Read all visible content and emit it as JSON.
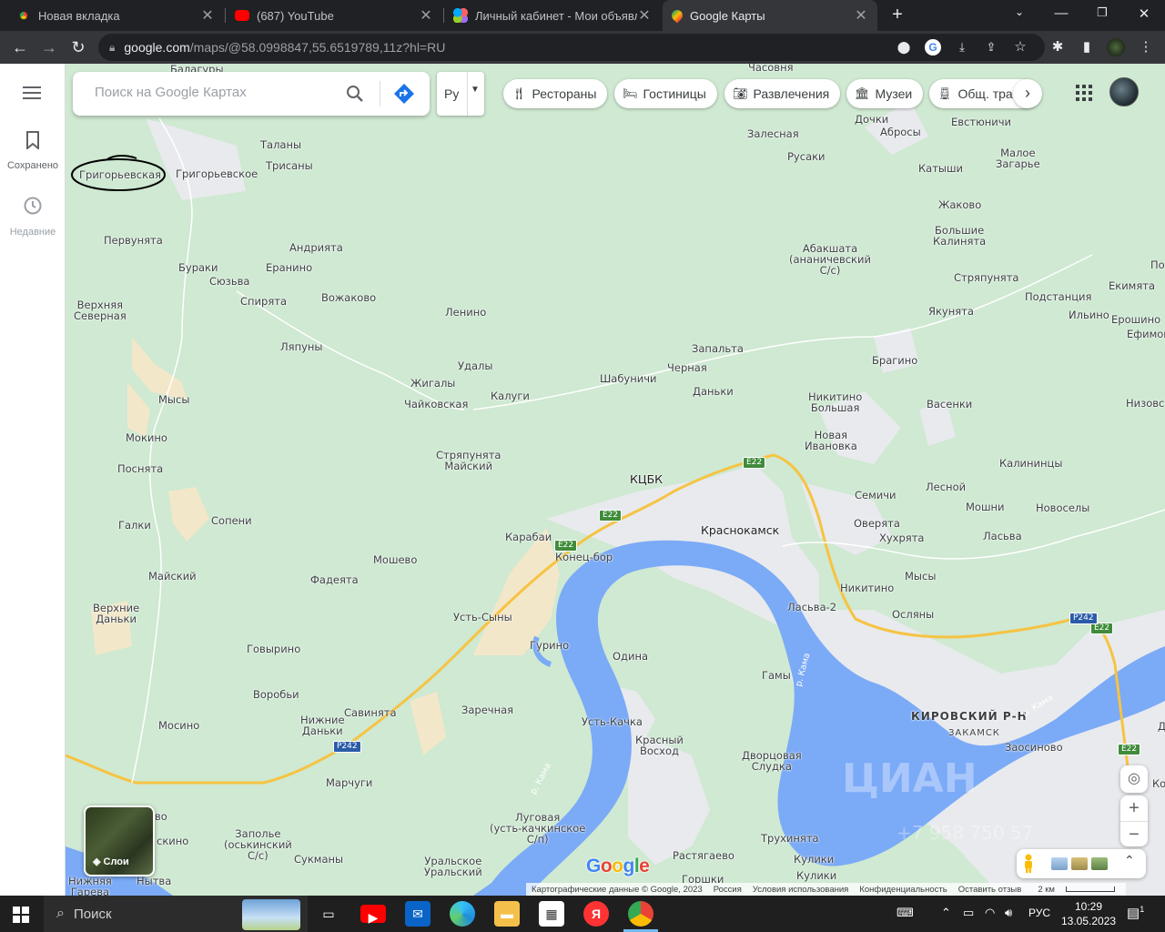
{
  "browser": {
    "tabs": [
      {
        "title": "Новая вкладка",
        "favicon": "chrome-icon",
        "active": false
      },
      {
        "title": "(687) YouTube",
        "favicon": "youtube-icon",
        "active": false
      },
      {
        "title": "Личный кабинет - Мои объявления",
        "favicon": "avito-icon",
        "active": false
      },
      {
        "title": "Google Карты",
        "favicon": "google-maps-icon",
        "active": true
      }
    ],
    "url_host": "google.com",
    "url_rest": "/maps/@58.0998847,55.6519789,11z?hl=RU"
  },
  "maps": {
    "search_placeholder": "Поиск на Google Картах",
    "language": "Ру",
    "sidebar": [
      {
        "label": "Сохранено",
        "icon": "bookmark-icon"
      },
      {
        "label": "Недавние",
        "icon": "history-icon"
      }
    ],
    "chips": [
      {
        "label": "Рестораны",
        "icon": "restaurant-icon"
      },
      {
        "label": "Гостиницы",
        "icon": "hotel-icon"
      },
      {
        "label": "Развлечения",
        "icon": "camera-icon"
      },
      {
        "label": "Музеи",
        "icon": "museum-icon"
      },
      {
        "label": "Общ. тра",
        "icon": "transit-icon"
      }
    ],
    "layers_label": "Слои",
    "attribution": [
      "Картографические данные © Google, 2023",
      "Россия",
      "Условия использования",
      "Конфиденциальность",
      "Оставить отзыв",
      "2 км"
    ],
    "logo": "Google",
    "watermark": "ЦИАН",
    "watermark_sub": "+7 958 750 57",
    "labels": {
      "balagury": "Балагуры",
      "chasovnya": "Часовня",
      "grigorevskaya": "Григорьевская",
      "grigorevskoe": "Григорьевское",
      "talany": "Таланы",
      "trisany": "Трисаны",
      "zalesnaya": "Залесная",
      "rusaki": "Русаки",
      "dochki": "Дочки",
      "abrosy": "Абросы",
      "evstyunichi": "Евстюничи",
      "maloe_zagare": "Малое\nЗагарье",
      "katyshi": "Катыши",
      "zhakovo": "Жаково",
      "bolshie_kalinyata": "Большие\nКалинята",
      "pervunyata": "Первунята",
      "andriyata": "Андрията",
      "buraki": "Бураки",
      "eranino": "Еранино",
      "syuzva": "Сюзьва",
      "spiryata": "Спирята",
      "vozhakovo": "Вожаково",
      "verkhnyaya_severnaya": "Верхняя\nСеверная",
      "lenino": "Ленино",
      "abakshata": "Абакшата\n(ананичевский\nС/с)",
      "stryapunyata": "Стряпунята",
      "ekimyata": "Екимята",
      "po": "По",
      "podstanciya": "Подстанция",
      "yakunyata": "Якунята",
      "ilino": "Ильино",
      "eroshino": "Ерошино",
      "efimov": "Ефимов",
      "lyapuny": "Ляпуны",
      "zapalta": "Запальта",
      "udaly": "Удалы",
      "zhigaly": "Жигалы",
      "chernaya": "Черная",
      "shabunichi": "Шабуничи",
      "bragino": "Брагино",
      "kalugi": "Калуги",
      "chaikovskaya": "Чайковская",
      "danki": "Даньки",
      "nikitino_bolshaya": "Никитино\nБольшая",
      "vasenki": "Васенки",
      "nizovs": "Низовс",
      "mysy": "Мысы",
      "mokino": "Мокино",
      "novaya_ivanovka": "Новая\nИвановка",
      "stryapunyata_maiskii": "Стряпунята\nМайский",
      "posnyata": "Поснята",
      "kcbk": "КЦБК",
      "kalinincy": "Калининцы",
      "semichi": "Семичи",
      "lesnoi": "Лесной",
      "mochni": "Мошни",
      "novosely": "Новоселы",
      "sopeni": "Сопени",
      "galki": "Галки",
      "karabai": "Карабаи",
      "krasnokamsk": "Краснокамск",
      "overyata": "Оверята",
      "khukhryata": "Хухрята",
      "lasva": "Ласьва",
      "moshevo": "Мошево",
      "konec_bor": "Конец-бор",
      "maiskii": "Майский",
      "fadeyata": "Фадеята",
      "nikitino": "Никитино",
      "mysy2": "Мысы",
      "lasva2": "Ласьва-2",
      "oslyany": "Осляны",
      "verkhnie_danki": "Верхние\nДаньки",
      "ust_syny": "Усть-Сыны",
      "gurino": "Гурино",
      "odina": "Одина",
      "govyrino": "Говырино",
      "gamy": "Гамы",
      "vorobyi": "Воробьи",
      "kirovskii": "КИРОВСКИЙ Р-Н",
      "zakamsk": "ЗАКАМСК",
      "savinyata": "Савинята",
      "zarechnaya": "Заречная",
      "nizhnie_danki": "Нижние\nДаньки",
      "ust_kachka": "Усть-Качка",
      "mosino": "Мосино",
      "krasnyi_voskhod": "Красный\nВосход",
      "dvorcovaya": "Дворцовая\nСлудка",
      "zaosinovo": "Заосиново",
      "marchugi": "Марчуги",
      "vo": "во",
      "zapole": "Заполье\n(оськинский\nС/с)",
      "skino": "скино",
      "lugovaya": "Луговая\n(усть-качкинское\nС/п)",
      "trukhinyata": "Трухинята",
      "sukmany": "Сукманы",
      "uralskoe": "Уральское\nУральский",
      "rastyagaevo": "Растягаево",
      "kuliki": "Кулики",
      "kuliki2": "Кулики",
      "gorshki": "Горшки",
      "nizhnyaya": "Нижняя\nГарева",
      "nytva": "Нытва",
      "ko": "Ко",
      "d": "Д",
      "river_kama_1": "р. Кама",
      "river_kama_2": "р. Кама",
      "river_kama_3": "р. Кама",
      "e22_1": "E22",
      "e22_2": "E22",
      "e22_3": "E22",
      "e22_4": "E22",
      "e22_5": "E22",
      "p242_1": "P242",
      "p242_2": "P242"
    }
  },
  "taskbar": {
    "search_placeholder": "Поиск",
    "apps": [
      "taskview-icon",
      "youtube-icon",
      "mail-icon",
      "edge-icon",
      "explorer-icon",
      "store-icon",
      "yandex-icon",
      "chrome-icon"
    ],
    "lang": "РУС",
    "time": "10:29",
    "date": "13.05.2023",
    "notifications": "1"
  },
  "colors": {
    "water": "#7baaf7",
    "land": "#cfe9d2",
    "urban": "#e8eaed",
    "road": "#f6c342",
    "sand": "#f3e7c9",
    "river_label": "#ffffff"
  }
}
